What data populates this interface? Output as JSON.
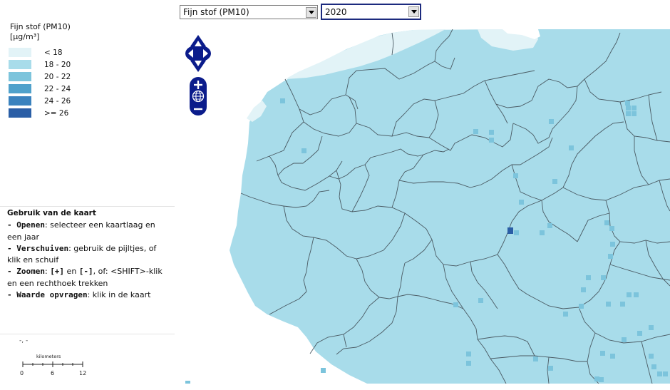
{
  "controls": {
    "layer": "Fijn stof (PM10)",
    "year": "2020"
  },
  "legend": {
    "title_line1": "Fijn stof (PM10)",
    "title_line2": "[µg/m³]",
    "classes": [
      {
        "label": "< 18",
        "color": "#e2f3f7"
      },
      {
        "label": "18 - 20",
        "color": "#a8dcea"
      },
      {
        "label": "20 - 22",
        "color": "#7cc4dc"
      },
      {
        "label": "22 - 24",
        "color": "#4fa1cb"
      },
      {
        "label": "24 - 26",
        "color": "#3a82be"
      },
      {
        "label": ">= 26",
        "color": "#2a5ea6"
      }
    ]
  },
  "help": {
    "title": "Gebruik van de kaart",
    "open_key": "- Openen",
    "open_text": ": selecteer een kaartlaag en een jaar",
    "move_key": "- Verschuiven",
    "move_text": ": gebruik de pijltjes, of klik en schuif",
    "zoom_key": "- Zoomen",
    "zoom_mid": ": ",
    "zoom_plus": "[+]",
    "zoom_en": " en ",
    "zoom_minus": "[-]",
    "zoom_text": ", of: <SHIFT>-klik en een rechthoek trekken",
    "value_key": "- Waarde opvragen",
    "value_text": ": klik in de kaart"
  },
  "coords": "-, -",
  "scale": {
    "unit": "kilometers",
    "ticks": [
      "0",
      "6",
      "12"
    ]
  },
  "map": {
    "land_color": "#a8dcea",
    "border_color": "#4a5a63",
    "light_color": "#e2f3f7",
    "mid_color": "#7cc4dc",
    "dark_color": "#2a5ea6"
  },
  "nav_icons": {
    "pan": "pan-arrows-icon",
    "zoom_in": "zoom-in-icon",
    "world": "globe-icon",
    "zoom_out": "zoom-out-icon"
  }
}
